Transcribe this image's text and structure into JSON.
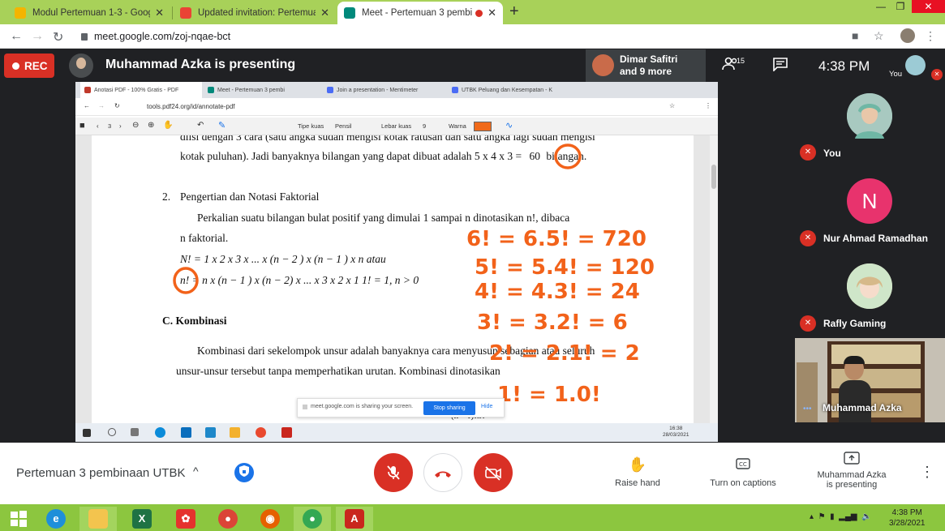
{
  "browser": {
    "tabs": [
      {
        "label": "Modul Pertemuan 1-3 - Google D",
        "color": "#f4b400"
      },
      {
        "label": "Updated invitation: Pertemuan 3",
        "color": "#ea4335"
      },
      {
        "label": "Meet - Pertemuan 3 pembina",
        "color": "#00897b"
      }
    ],
    "url": "meet.google.com/zoj-nqae-bct"
  },
  "meet_top": {
    "rec_label": "REC",
    "presenting_title": "Muhammad Azka is presenting",
    "others_line1": "Dimar Safitri",
    "others_line2": "and 9 more",
    "people_count": "15",
    "time": "4:38 PM",
    "you_label": "You"
  },
  "shared": {
    "tabs": [
      "Anotasi PDF - 100% Gratis - PDF",
      "Meet - Pertemuan 3 pembi",
      "Join a presentation - Mentimeter",
      "UTBK Peluang dan Kesempatan - K"
    ],
    "url": "tools.pdf24.org/id/annotate-pdf",
    "toolbar": {
      "page_num": "3",
      "brush_type_label": "Tipe kuas",
      "brush_type_value": "Pensil",
      "brush_width_label": "Lebar kuas",
      "brush_width_value": "9",
      "color_label": "Warna"
    },
    "doc": {
      "line1": "diisi dengan 3 cara (satu angka sudah mengisi kotak ratusan dan satu angka lagi sudah mengisi",
      "line2_pre": "kotak puluhan). Jadi banyaknya bilangan yang dapat dibuat adalah 5 x 4 x 3 =",
      "line2_num": "60",
      "line2_post": "bilangan.",
      "section_num": "2.",
      "section_title": "Pengertian dan Notasi Faktorial",
      "para1": "Perkalian suatu bilangan bulat positif yang dimulai 1 sampai n dinotasikan n!, dibaca",
      "para2": "n faktorial.",
      "formula1": "N! = 1 x 2 x 3 x ... x (n − 2 ) x (n − 1 ) x n   atau",
      "formula2": "n! = n x (n − 1 ) x (n − 2) x ... x 3 x 2 x 1 1! = 1, n > 0",
      "heading_c": "C. Kombinasi",
      "para3": "Kombinasi dari sekelompok unsur adalah banyaknya cara menyusun sebagian atau seluruh",
      "para4": "unsur-unsur tersebut tanpa memperhatikan urutan. Kombinasi dinotasikan",
      "partial_formula": "(n − r)!.r!"
    },
    "handwriting": [
      "6! = 6.5! = 720",
      "5! = 5.4! = 120",
      "4! = 4.3! = 24",
      "3! = 3.2! = 6",
      "2! = 2.1! = 2",
      "1! = 1.0!"
    ],
    "share_popup": {
      "text": "meet.google.com is sharing your screen.",
      "stop": "Stop sharing",
      "hide": "Hide"
    },
    "taskbar_time": "16:38",
    "taskbar_date": "28/03/2021"
  },
  "participants": [
    {
      "name": "You",
      "avatar_color": "#7fb3a4"
    },
    {
      "name": "Nur Ahmad Ramadhan",
      "initial": "N",
      "avatar_color": "#e8336d"
    },
    {
      "name": "Rafly Gaming",
      "avatar_color": "#d8c8a8"
    }
  ],
  "presenter_tile_name": "Muhammad Azka",
  "bottom": {
    "meeting_title": "Pertemuan 3 pembinaan UTBK",
    "raise_hand": "Raise hand",
    "captions": "Turn on captions",
    "presenting_line1": "Muhammad Azka",
    "presenting_line2": "is presenting"
  },
  "windows": {
    "time": "4:38 PM",
    "date": "3/28/2021"
  },
  "colors": {
    "ink": "#f2621a",
    "meet_red": "#d93025",
    "chrome_frame": "#a8d159",
    "taskbar": "#8cc63f"
  }
}
